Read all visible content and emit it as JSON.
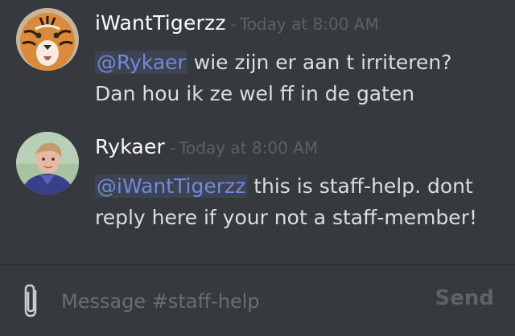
{
  "channel": {
    "name": "staff-help"
  },
  "messages": [
    {
      "author": "iWantTigerzz",
      "separator": "-",
      "timestamp": "Today at 8:00 AM",
      "avatar_icon": "tiger-avatar",
      "mention": "@Rykaer",
      "text_line1": " wie zijn er aan t irriteren?",
      "text_line2": "Dan hou ik ze wel ff in de gaten"
    },
    {
      "author": "Rykaer",
      "separator": "-",
      "timestamp": "Today at 8:00 AM",
      "avatar_icon": "user-photo-avatar",
      "mention": "@iWantTigerzz",
      "text_line1": " this is staff-help. dont",
      "text_line2": "reply here if your not a staff-member!"
    }
  ],
  "composer": {
    "placeholder": "Message #staff-help",
    "value": "",
    "send_label": "Send",
    "attach_icon": "paperclip-icon"
  },
  "colors": {
    "background": "#36393e",
    "mention": "#7289da",
    "username": "#ffffff",
    "text": "#dcddde",
    "timestamp": "#5d6066",
    "send_disabled": "#5f6268"
  }
}
